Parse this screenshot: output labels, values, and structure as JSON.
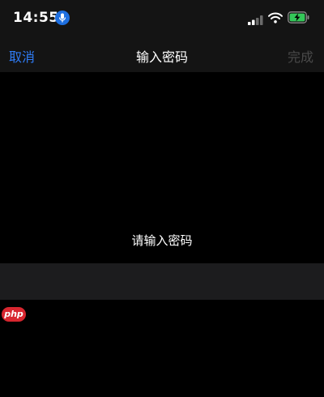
{
  "status_bar": {
    "time": "14:55",
    "icons": [
      "microphone-icon",
      "cellular-signal-icon",
      "wifi-icon",
      "battery-charging-icon"
    ],
    "mic_color": "#1e6fe0",
    "battery_color": "#34c759"
  },
  "nav": {
    "cancel_label": "取消",
    "title": "输入密码",
    "done_label": "完成",
    "cancel_color": "#2f7cf6",
    "done_color": "#4a4a4a"
  },
  "content": {
    "prompt": "请输入密码",
    "password_value": "",
    "password_placeholder": ""
  },
  "watermark": {
    "text": "php"
  }
}
